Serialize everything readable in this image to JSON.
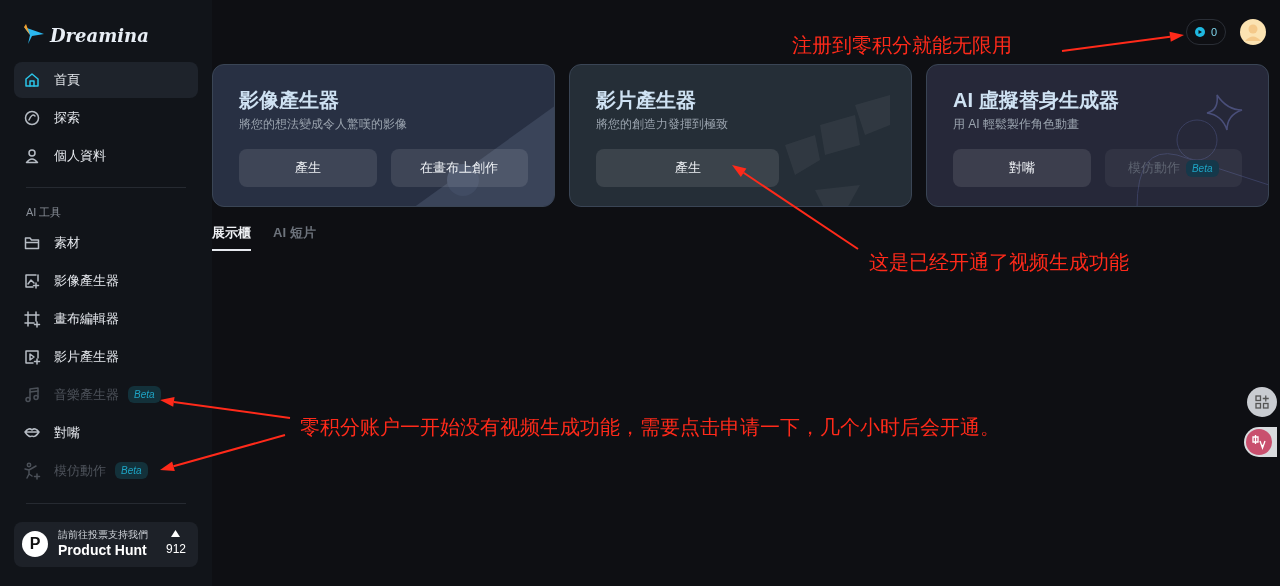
{
  "logo": {
    "text": "Dreamina"
  },
  "sidebar": {
    "nav": [
      {
        "label": "首頁",
        "selected": true
      },
      {
        "label": "探索",
        "selected": false
      },
      {
        "label": "個人資料",
        "selected": false
      }
    ],
    "section_title": "AI 工具",
    "tools": [
      {
        "label": "素材",
        "disabled": false
      },
      {
        "label": "影像產生器",
        "disabled": false
      },
      {
        "label": "畫布編輯器",
        "disabled": false
      },
      {
        "label": "影片產生器",
        "disabled": false
      },
      {
        "label": "音樂產生器",
        "disabled": true,
        "badge": "Beta"
      },
      {
        "label": "對嘴",
        "disabled": false
      },
      {
        "label": "模仿動作",
        "disabled": true,
        "badge": "Beta"
      }
    ],
    "product_hunt": {
      "letter": "P",
      "caption": "請前往投票支持我們",
      "name": "Product Hunt",
      "count": "912"
    }
  },
  "header": {
    "credits": "0"
  },
  "cards": [
    {
      "title": "影像產生器",
      "subtitle": "將您的想法變成令人驚嘆的影像",
      "buttons": [
        {
          "label": "產生",
          "disabled": false
        },
        {
          "label": "在畫布上創作",
          "disabled": false
        }
      ]
    },
    {
      "title": "影片產生器",
      "subtitle": "將您的創造力發揮到極致",
      "buttons": [
        {
          "label": "產生",
          "disabled": false
        }
      ]
    },
    {
      "title": "AI 虛擬替身生成器",
      "subtitle": "用 AI 輕鬆製作角色動畫",
      "buttons": [
        {
          "label": "對嘴",
          "disabled": false
        },
        {
          "label": "模仿動作",
          "disabled": true,
          "badge": "Beta"
        }
      ]
    }
  ],
  "tabs": [
    {
      "label": "展示櫃",
      "selected": true
    },
    {
      "label": "AI 短片",
      "selected": false
    }
  ],
  "annotations": [
    {
      "text": "注册到零积分就能无限用"
    },
    {
      "text": "这是已经开通了视频生成功能"
    },
    {
      "text": "零积分账户一开始没有视频生成功能，需要点击申请一下，几个小时后会开通。"
    }
  ]
}
